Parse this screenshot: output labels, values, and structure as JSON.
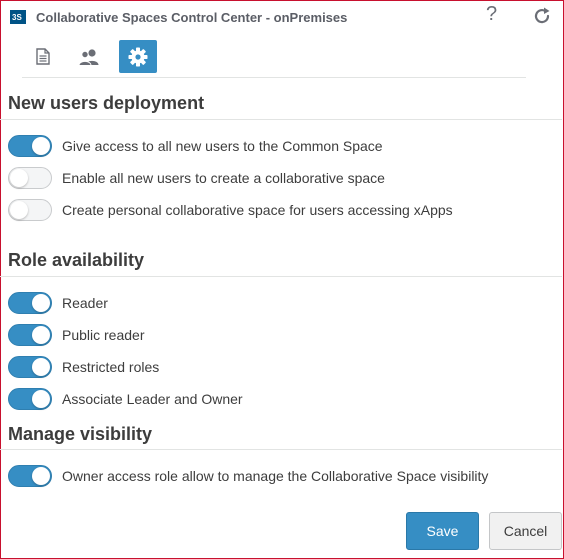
{
  "window": {
    "title": "Collaborative Spaces Control Center - onPremises"
  },
  "header_icons": {
    "help": "?",
    "refresh": "refresh-icon"
  },
  "tabs": [
    {
      "name": "document-icon",
      "active": false
    },
    {
      "name": "users-icon",
      "active": false
    },
    {
      "name": "gear-icon",
      "active": true
    }
  ],
  "sections": {
    "new_users": {
      "title": "New users deployment",
      "items": [
        {
          "label": "Give access to all new users to the Common Space",
          "enabled": true
        },
        {
          "label": "Enable all new users to create a collaborative space",
          "enabled": false
        },
        {
          "label": "Create personal collaborative space for users accessing xApps",
          "enabled": false
        }
      ]
    },
    "role": {
      "title": "Role availability",
      "items": [
        {
          "label": "Reader",
          "enabled": true
        },
        {
          "label": "Public reader",
          "enabled": true
        },
        {
          "label": "Restricted roles",
          "enabled": true
        },
        {
          "label": "Associate Leader and Owner",
          "enabled": true
        }
      ]
    },
    "visibility": {
      "title": "Manage visibility",
      "items": [
        {
          "label": "Owner access role allow to manage the Collaborative Space visibility",
          "enabled": true
        }
      ]
    }
  },
  "buttons": {
    "save": "Save",
    "cancel": "Cancel"
  },
  "colors": {
    "accent": "#368ec4",
    "frame": "#c8102e"
  }
}
